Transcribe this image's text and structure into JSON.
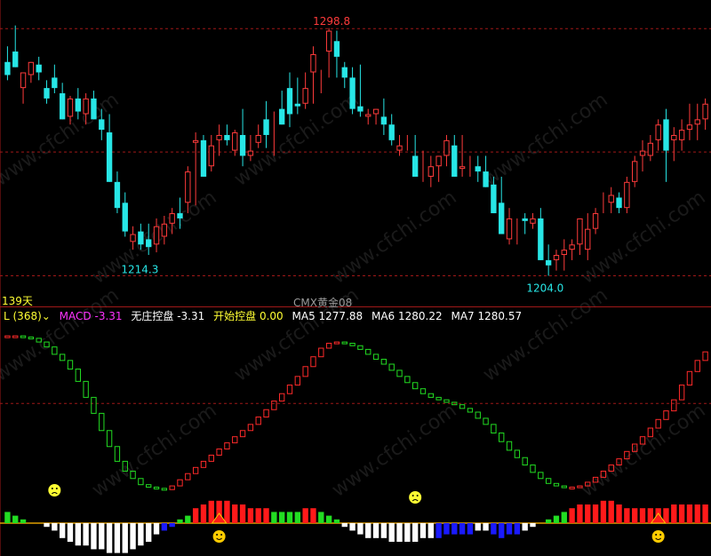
{
  "chart_data": [
    {
      "type": "candlestick",
      "title": "CMX黄金08",
      "period_label": "139天",
      "annotations": {
        "high": "1298.8",
        "low_left": "1214.3",
        "low_right": "1204.0"
      },
      "colors": {
        "up": "#ff3b3b",
        "down": "#27e6e6",
        "grid": "#a01818"
      },
      "ohlc": [
        [
          1286,
          1292,
          1279,
          1281
        ],
        [
          1290,
          1300,
          1284,
          1284
        ],
        [
          1276,
          1282,
          1270,
          1282
        ],
        [
          1281,
          1286,
          1278,
          1286
        ],
        [
          1285,
          1288,
          1279,
          1282
        ],
        [
          1276,
          1279,
          1270,
          1272
        ],
        [
          1280,
          1285,
          1274,
          1276
        ],
        [
          1274,
          1278,
          1264,
          1264
        ],
        [
          1265,
          1273,
          1262,
          1272
        ],
        [
          1272,
          1276,
          1264,
          1267
        ],
        [
          1266,
          1274,
          1262,
          1272
        ],
        [
          1272,
          1275,
          1264,
          1264
        ],
        [
          1264,
          1268,
          1256,
          1260
        ],
        [
          1259,
          1266,
          1240,
          1240
        ],
        [
          1240,
          1244,
          1228,
          1230
        ],
        [
          1232,
          1236,
          1219,
          1221
        ],
        [
          1217,
          1223,
          1214,
          1220
        ],
        [
          1221,
          1224,
          1214,
          1216
        ],
        [
          1218,
          1224,
          1212,
          1215
        ],
        [
          1216,
          1226,
          1213,
          1223
        ],
        [
          1219,
          1227,
          1216,
          1224
        ],
        [
          1224,
          1230,
          1220,
          1228
        ],
        [
          1228,
          1234,
          1222,
          1226
        ],
        [
          1232,
          1246,
          1228,
          1244
        ],
        [
          1255,
          1259,
          1231,
          1256
        ],
        [
          1256,
          1258,
          1242,
          1242
        ],
        [
          1246,
          1258,
          1244,
          1254
        ],
        [
          1256,
          1262,
          1250,
          1258
        ],
        [
          1258,
          1262,
          1254,
          1256
        ],
        [
          1252,
          1260,
          1250,
          1259
        ],
        [
          1258,
          1268,
          1246,
          1250
        ],
        [
          1250,
          1258,
          1248,
          1252
        ],
        [
          1255,
          1262,
          1253,
          1258
        ],
        [
          1264,
          1271,
          1253,
          1258
        ],
        [
          1261,
          1267,
          1250,
          1261
        ],
        [
          1268,
          1275,
          1262,
          1262
        ],
        [
          1276,
          1282,
          1261,
          1266
        ],
        [
          1270,
          1280,
          1266,
          1269
        ],
        [
          1270,
          1282,
          1268,
          1276
        ],
        [
          1282,
          1292,
          1270,
          1289
        ],
        [
          1278,
          1283,
          1274,
          1278
        ],
        [
          1290,
          1299,
          1280,
          1298
        ],
        [
          1294,
          1298,
          1280,
          1288
        ],
        [
          1284,
          1286,
          1276,
          1280
        ],
        [
          1280,
          1284,
          1266,
          1268
        ],
        [
          1269,
          1285,
          1265,
          1267
        ],
        [
          1265,
          1268,
          1262,
          1266
        ],
        [
          1266,
          1268,
          1262,
          1268
        ],
        [
          1265,
          1272,
          1258,
          1262
        ],
        [
          1262,
          1266,
          1254,
          1256
        ],
        [
          1252,
          1258,
          1250,
          1254
        ],
        [
          1254,
          1258,
          1252,
          1254
        ],
        [
          1250,
          1258,
          1242,
          1242
        ],
        [
          1244,
          1252,
          1240,
          1244
        ],
        [
          1242,
          1250,
          1238,
          1246
        ],
        [
          1246,
          1250,
          1240,
          1250
        ],
        [
          1250,
          1258,
          1246,
          1256
        ],
        [
          1254,
          1258,
          1242,
          1242
        ],
        [
          1245,
          1258,
          1242,
          1246
        ],
        [
          1246,
          1250,
          1242,
          1246
        ],
        [
          1246,
          1250,
          1240,
          1244
        ],
        [
          1244,
          1250,
          1238,
          1238
        ],
        [
          1239,
          1242,
          1228,
          1228
        ],
        [
          1232,
          1242,
          1222,
          1220
        ],
        [
          1218,
          1230,
          1216,
          1226
        ],
        [
          1222,
          1226,
          1216,
          1222
        ],
        [
          1226,
          1228,
          1220,
          1225
        ],
        [
          1224,
          1228,
          1222,
          1226
        ],
        [
          1226,
          1230,
          1210,
          1210
        ],
        [
          1210,
          1216,
          1204,
          1208
        ],
        [
          1210,
          1214,
          1206,
          1212
        ],
        [
          1212,
          1218,
          1206,
          1214
        ],
        [
          1214,
          1218,
          1210,
          1216
        ],
        [
          1216,
          1226,
          1212,
          1226
        ],
        [
          1214,
          1228,
          1210,
          1222
        ],
        [
          1222,
          1230,
          1220,
          1228
        ],
        [
          1230,
          1236,
          1228,
          1230
        ],
        [
          1232,
          1238,
          1228,
          1235
        ],
        [
          1234,
          1236,
          1228,
          1230
        ],
        [
          1230,
          1242,
          1228,
          1240
        ],
        [
          1240,
          1250,
          1238,
          1248
        ],
        [
          1250,
          1256,
          1244,
          1252
        ],
        [
          1250,
          1258,
          1248,
          1255
        ],
        [
          1256,
          1264,
          1252,
          1262
        ],
        [
          1264,
          1268,
          1240,
          1252
        ],
        [
          1256,
          1261,
          1248,
          1258
        ],
        [
          1256,
          1264,
          1252,
          1260
        ],
        [
          1260,
          1270,
          1256,
          1262
        ],
        [
          1262,
          1270,
          1256,
          1264
        ],
        [
          1264,
          1272,
          1260,
          1270
        ]
      ],
      "y_range": [
        1196,
        1305
      ]
    },
    {
      "type": "indicator",
      "header": {
        "prefix": "L (368)",
        "dropdown_arrow": "chevron-down",
        "items": [
          {
            "name": "MACD",
            "value": "-3.31",
            "color": "#ff33ff"
          },
          {
            "name": "无庄控盘",
            "value": "-3.31",
            "color": "#ffffff"
          },
          {
            "name": "开始控盘",
            "value": "0.00",
            "color": "#ffff33"
          },
          {
            "name": "MA5",
            "value": "1277.88",
            "color": "#ffffff"
          },
          {
            "name": "MA6",
            "value": "1280.22",
            "color": "#ffffff"
          },
          {
            "name": "MA7",
            "value": "1280.57",
            "color": "#ffffff"
          }
        ]
      },
      "line_values": [
        95,
        95,
        94,
        93,
        90,
        86,
        80,
        75,
        68,
        58,
        45,
        32,
        18,
        5,
        -7,
        -15,
        -21,
        -26,
        -28,
        -29,
        -30,
        -27,
        -22,
        -17,
        -12,
        -7,
        -2,
        3,
        8,
        13,
        18,
        23,
        29,
        35,
        42,
        48,
        55,
        62,
        70,
        78,
        85,
        89,
        90,
        89,
        87,
        84,
        80,
        76,
        72,
        67,
        62,
        57,
        52,
        48,
        45,
        43,
        41,
        39,
        36,
        33,
        28,
        23,
        16,
        9,
        2,
        -4,
        -10,
        -16,
        -21,
        -25,
        -27,
        -28,
        -28,
        -27,
        -24,
        -20,
        -15,
        -10,
        -5,
        1,
        7,
        13,
        20,
        27,
        34,
        43,
        55,
        66,
        75,
        82
      ],
      "line_range": [
        -32,
        98
      ],
      "histogram": [
        3,
        2,
        1,
        0,
        0,
        -1,
        -2,
        -4,
        -5,
        -6,
        -6,
        -7,
        -7,
        -8,
        -8,
        -8,
        -7,
        -6,
        -5,
        -3,
        -2,
        -1,
        1,
        2,
        4,
        5,
        6,
        6,
        6,
        5,
        5,
        4,
        4,
        4,
        3,
        3,
        3,
        3,
        4,
        4,
        3,
        2,
        1,
        -1,
        -2,
        -3,
        -4,
        -4,
        -4,
        -5,
        -5,
        -5,
        -5,
        -4,
        -4,
        -4,
        -3,
        -3,
        -3,
        -3,
        -2,
        -2,
        -3,
        -4,
        -3,
        -3,
        -2,
        -1,
        0,
        1,
        2,
        3,
        4,
        5,
        5,
        5,
        6,
        6,
        5,
        4,
        4,
        4,
        4,
        4,
        4,
        5,
        5,
        5,
        5,
        5
      ],
      "histogram_colors": {
        "pos_high": "#ff1a1a",
        "pos_low": "#22dd22",
        "neg_shallow": "#ffffff",
        "neg_deep": "#1a1aff"
      },
      "markers": [
        {
          "type": "sad",
          "at": 6
        },
        {
          "type": "sad",
          "at": 52
        },
        {
          "type": "smile",
          "at": 27
        },
        {
          "type": "smile",
          "at": 83
        }
      ],
      "watermark": "www.cfchi.com"
    }
  ]
}
